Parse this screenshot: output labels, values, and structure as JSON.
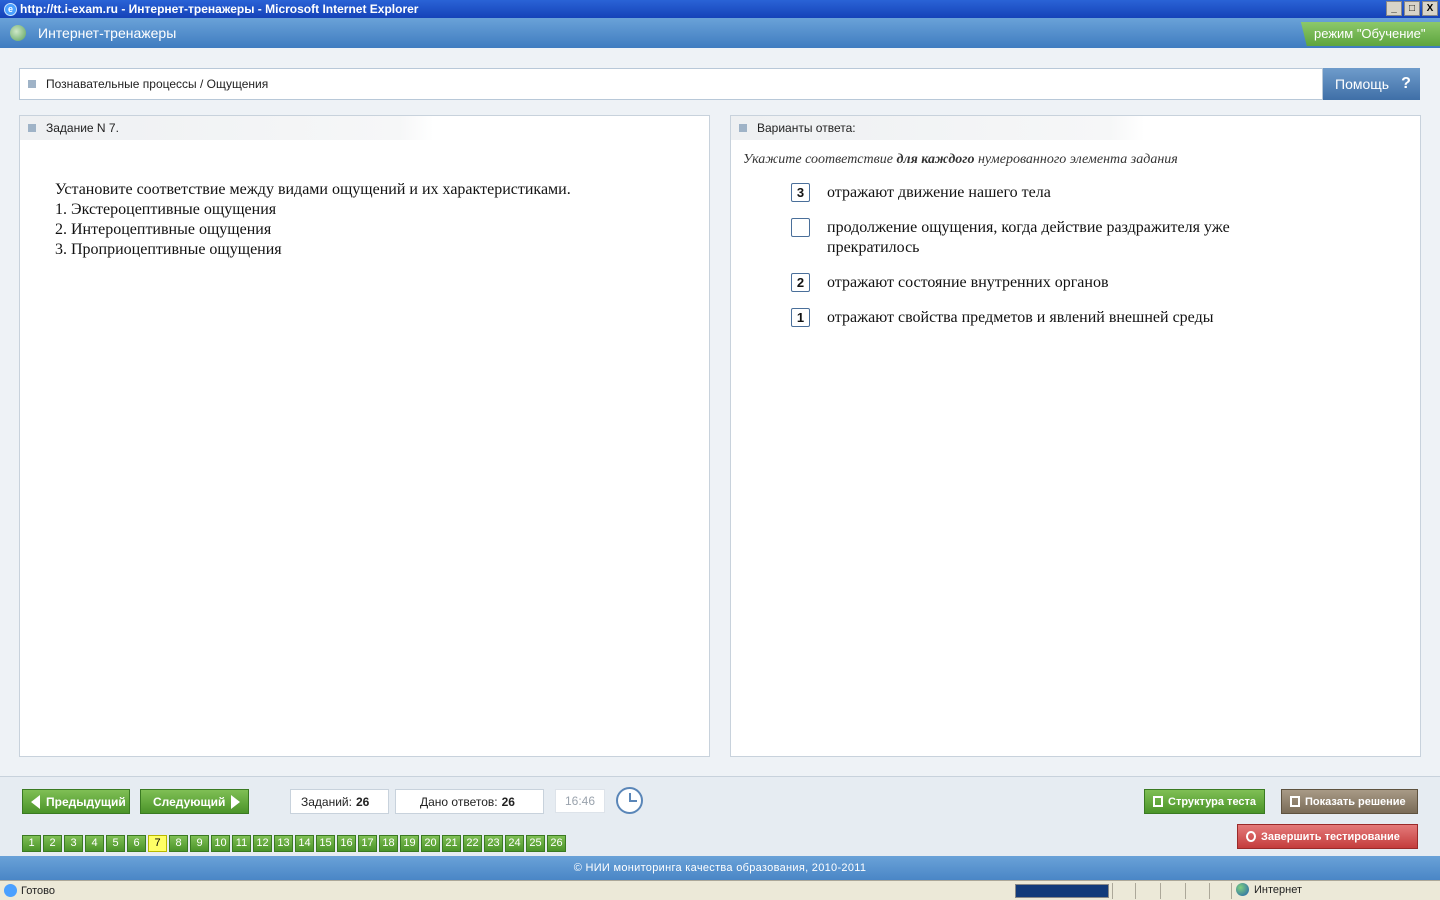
{
  "window": {
    "title": "http://tt.i-exam.ru - Интернет-тренажеры - Microsoft Internet Explorer",
    "minimize": "_",
    "maximize": "□",
    "close": "X"
  },
  "app": {
    "title": "Интернет-тренажеры",
    "mode": "режим \"Обучение\""
  },
  "breadcrumb": "Познавательные процессы / Ощущения",
  "help_label": "Помощь",
  "help_icon": "?",
  "task": {
    "header": "Задание N 7.",
    "lines": [
      "Установите соответствие между видами ощущений и их характеристиками.",
      "1. Экстероцептивные ощущения",
      "2. Интероцептивные ощущения",
      "3. Проприоцептивные ощущения"
    ]
  },
  "answers": {
    "header": "Варианты ответа:",
    "instruction_pre": "Укажите соответствие ",
    "instruction_bold": "для каждого",
    "instruction_post": " нумерованного элемента задания",
    "options": [
      {
        "value": "3",
        "text": "отражают движение нашего тела"
      },
      {
        "value": "",
        "text": "продолжение ощущения, когда действие раздражителя уже прекратилось"
      },
      {
        "value": "2",
        "text": "отражают состояние внутренних органов"
      },
      {
        "value": "1",
        "text": "отражают свойства предметов и явлений внешней среды"
      }
    ]
  },
  "nav": {
    "prev": "Предыдущий",
    "next": "Следующий",
    "tasks_label": "Заданий:",
    "tasks_value": "26",
    "answered_label": "Дано ответов:",
    "answered_value": "26",
    "timer": "16:46"
  },
  "actions": {
    "structure": "Структура теста",
    "show_solution": "Показать решение",
    "finish": "Завершить тестирование"
  },
  "pages": [
    "1",
    "2",
    "3",
    "4",
    "5",
    "6",
    "7",
    "8",
    "9",
    "10",
    "11",
    "12",
    "13",
    "14",
    "15",
    "16",
    "17",
    "18",
    "19",
    "20",
    "21",
    "22",
    "23",
    "24",
    "25",
    "26"
  ],
  "current_page": "7",
  "footer": "© НИИ мониторинга качества образования, 2010-2011",
  "status": {
    "text": "Готово",
    "zone": "Интернет"
  },
  "colors": {
    "accent_blue": "#4a86c6",
    "green_button": "#5ea53e",
    "current_page": "#ffff66"
  }
}
